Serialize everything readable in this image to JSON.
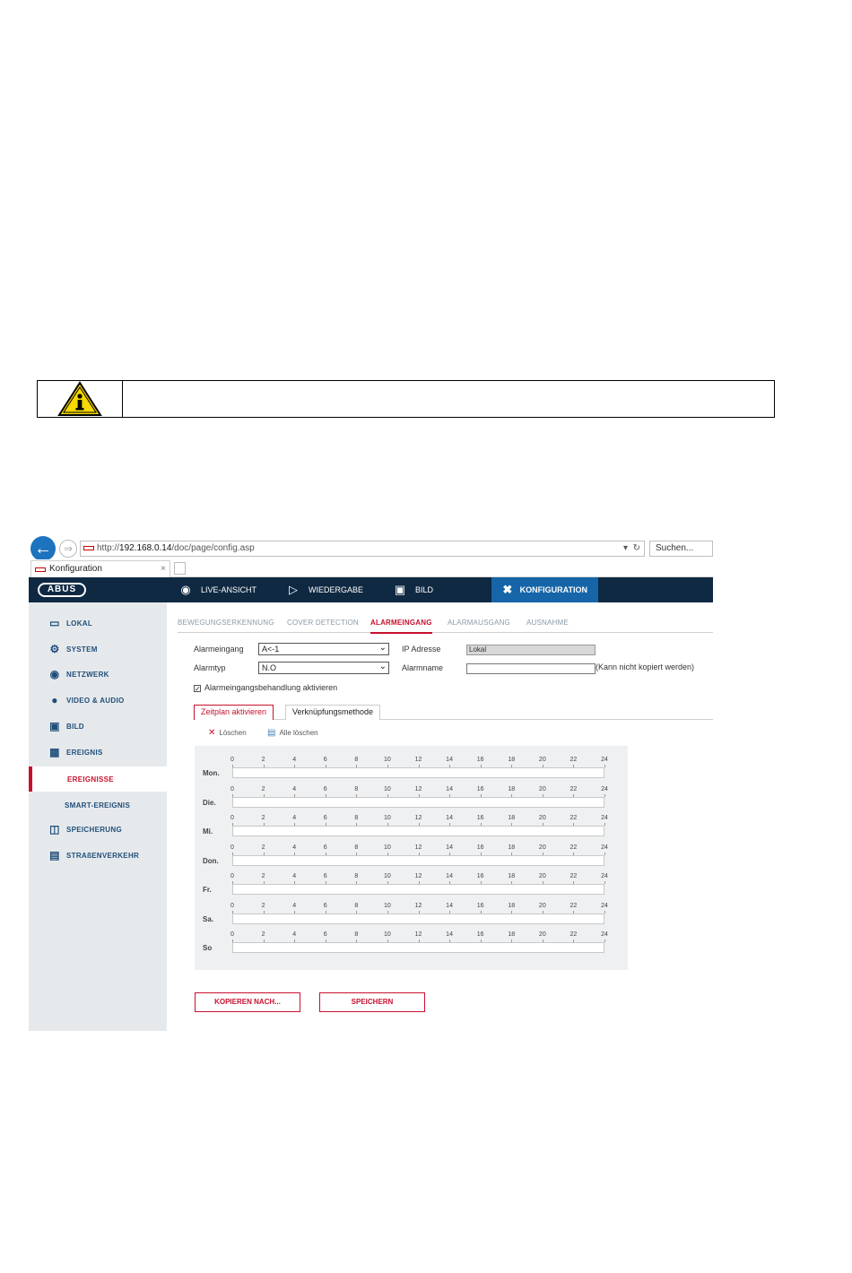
{
  "browser": {
    "url_prefix": "http://",
    "url_host": "192.168.0.14",
    "url_path": "/doc/page/config.asp",
    "search_placeholder": "Suchen...",
    "tab_title": "Konfiguration"
  },
  "topnav": {
    "logo": "ABUS",
    "items": [
      {
        "label": "LIVE-ANSICHT",
        "icon": "eye-icon"
      },
      {
        "label": "WIEDERGABE",
        "icon": "play-icon"
      },
      {
        "label": "BILD",
        "icon": "image-icon"
      },
      {
        "label": "KONFIGURATION",
        "icon": "tools-icon"
      }
    ]
  },
  "sidebar": {
    "items": [
      {
        "label": "LOKAL",
        "icon": "monitor-icon"
      },
      {
        "label": "SYSTEM",
        "icon": "gear-icon"
      },
      {
        "label": "NETZWERK",
        "icon": "network-icon"
      },
      {
        "label": "VIDEO & AUDIO",
        "icon": "microphone-icon"
      },
      {
        "label": "BILD",
        "icon": "image-icon"
      },
      {
        "label": "EREIGNIS",
        "icon": "calendar-icon"
      },
      {
        "label": "EREIGNISSE"
      },
      {
        "label": "SMART-EREIGNIS"
      },
      {
        "label": "SPEICHERUNG",
        "icon": "disk-icon"
      },
      {
        "label": "STRAßENVERKEHR",
        "icon": "traffic-icon"
      }
    ]
  },
  "subtabs": [
    "BEWEGUNGSERKENNUNG",
    "COVER DETECTION",
    "ALARMEINGANG",
    "ALARMAUSGANG",
    "AUSNAHME"
  ],
  "form": {
    "alarm_input_label": "Alarmeingang",
    "alarm_input_value": "A<-1",
    "alarm_type_label": "Alarmtyp",
    "alarm_type_value": "N.O",
    "ip_label": "IP Adresse",
    "ip_value": "Lokal",
    "alarm_name_label": "Alarmname",
    "alarm_name_value": "",
    "alarm_name_note": "(Kann nicht kopiert werden)",
    "enable_label": "Alarmeingangsbehandlung aktivieren",
    "enable_checked": "✓"
  },
  "mode_tabs": [
    "Zeitplan aktivieren",
    "Verknüpfungsmethode"
  ],
  "tools": {
    "delete": "Löschen",
    "delete_all": "Alle löschen"
  },
  "schedule": {
    "days": [
      "Mon.",
      "Die.",
      "Mi.",
      "Don.",
      "Fr.",
      "Sa.",
      "So"
    ],
    "hours": [
      "0",
      "2",
      "4",
      "6",
      "8",
      "10",
      "12",
      "14",
      "16",
      "18",
      "20",
      "22",
      "24"
    ]
  },
  "buttons": {
    "copy": "KOPIEREN NACH...",
    "save": "SPEICHERN"
  }
}
